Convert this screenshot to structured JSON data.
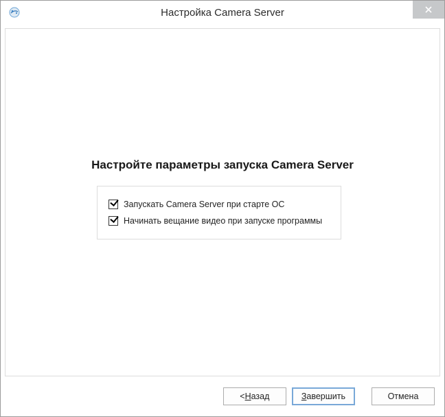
{
  "window": {
    "title": "Настройка Camera Server"
  },
  "page": {
    "heading": "Настройте параметры запуска Camera Server"
  },
  "options": {
    "start_with_os": {
      "label": "Запускать Camera Server при старте ОС",
      "checked": true
    },
    "start_broadcast": {
      "label": "Начинать вещание видео при запуске программы",
      "checked": true
    }
  },
  "buttons": {
    "back_prefix": "< ",
    "back_underline": "Н",
    "back_rest": "азад",
    "finish_underline": "З",
    "finish_rest": "авершить",
    "cancel": "Отмена"
  }
}
